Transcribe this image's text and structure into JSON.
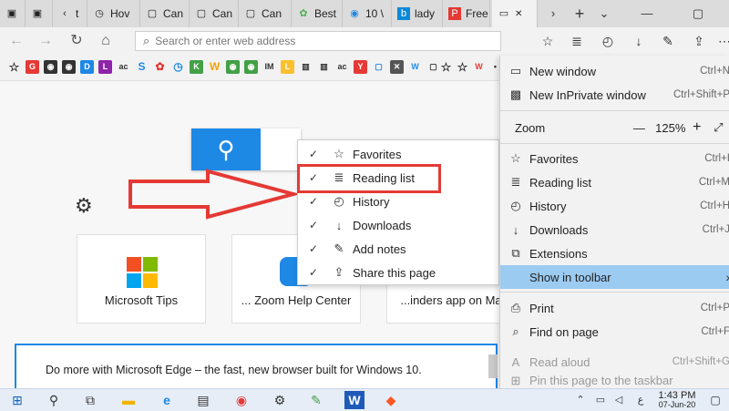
{
  "tabs": [
    {
      "label": "t"
    },
    {
      "label": "Hov"
    },
    {
      "label": "Can"
    },
    {
      "label": "Can"
    },
    {
      "label": "Can"
    },
    {
      "label": "Best"
    },
    {
      "label": "10 \\"
    },
    {
      "label": "lady"
    },
    {
      "label": "Free"
    }
  ],
  "address": {
    "placeholder": "Search or enter web address"
  },
  "page": {
    "tiles": [
      {
        "label": "Microsoft Tips"
      },
      {
        "label": "... Zoom Help Center"
      },
      {
        "label": "...inders app on Ma"
      }
    ],
    "banner_text": "Do more with Microsoft Edge – the fast, new browser built for Windows 10."
  },
  "toolbar_submenu": {
    "items": [
      {
        "label": "Favorites",
        "checked": true,
        "icon": "favorites-star-icon"
      },
      {
        "label": "Reading list",
        "checked": true,
        "icon": "reading-list-icon"
      },
      {
        "label": "History",
        "checked": true,
        "icon": "history-icon"
      },
      {
        "label": "Downloads",
        "checked": true,
        "icon": "download-icon"
      },
      {
        "label": "Add notes",
        "checked": true,
        "icon": "pen-icon"
      },
      {
        "label": "Share this page",
        "checked": true,
        "icon": "share-icon"
      }
    ]
  },
  "main_menu": {
    "new_window": {
      "label": "New window",
      "shortcut": "Ctrl+N"
    },
    "new_inprivate": {
      "label": "New InPrivate window",
      "shortcut": "Ctrl+Shift+P"
    },
    "zoom": {
      "label": "Zoom",
      "minus": "—",
      "value": "125%",
      "plus": "+"
    },
    "favorites": {
      "label": "Favorites",
      "shortcut": "Ctrl+I"
    },
    "reading_list": {
      "label": "Reading list",
      "shortcut": "Ctrl+M"
    },
    "history": {
      "label": "History",
      "shortcut": "Ctrl+H"
    },
    "downloads": {
      "label": "Downloads",
      "shortcut": "Ctrl+J"
    },
    "extensions": {
      "label": "Extensions"
    },
    "show_in_toolbar": {
      "label": "Show in toolbar"
    },
    "print": {
      "label": "Print",
      "shortcut": "Ctrl+P"
    },
    "find_on_page": {
      "label": "Find on page",
      "shortcut": "Ctrl+F"
    },
    "read_aloud": {
      "label": "Read aloud",
      "shortcut": "Ctrl+Shift+G"
    },
    "pin_taskbar": {
      "label": "Pin this page to the taskbar"
    }
  },
  "taskbar": {
    "time": "1:43 PM",
    "date": "07-Jun-20",
    "lang": "ع"
  },
  "colors": {
    "accent": "#1e88e5",
    "highlight": "#e53935",
    "menu_active": "#9ccbf1"
  }
}
